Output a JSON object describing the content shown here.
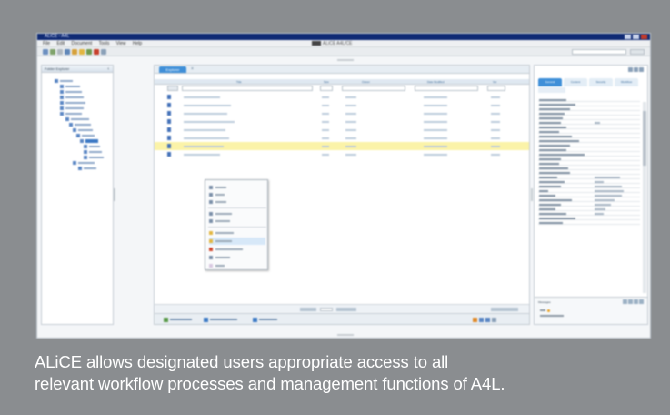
{
  "window": {
    "title": "ALiCE - A4L",
    "app_header": "ALiCE A4L/CE",
    "menu": [
      "File",
      "Edit",
      "Document",
      "Tools",
      "View",
      "Help"
    ]
  },
  "left_panel": {
    "header": "Folder Explorer"
  },
  "center": {
    "active_tab": "Explorer",
    "tab_close": "×",
    "columns": [
      "Title",
      "Size",
      "Owner",
      "Date Modified",
      "Ver"
    ]
  },
  "right_panel": {
    "tabs": [
      "General",
      "Content",
      "Security",
      "Workflow"
    ]
  },
  "messages": {
    "header": "Messages"
  },
  "caption": {
    "line1": "ALiCE allows designated users appropriate access to all",
    "line2": "relevant workflow processes and management functions of A4L."
  },
  "colors": {
    "accent": "#3f8fd8",
    "titlebar": "#0f2a74",
    "highlight_row": "#fbf3a8",
    "background": "#8a8d90"
  }
}
